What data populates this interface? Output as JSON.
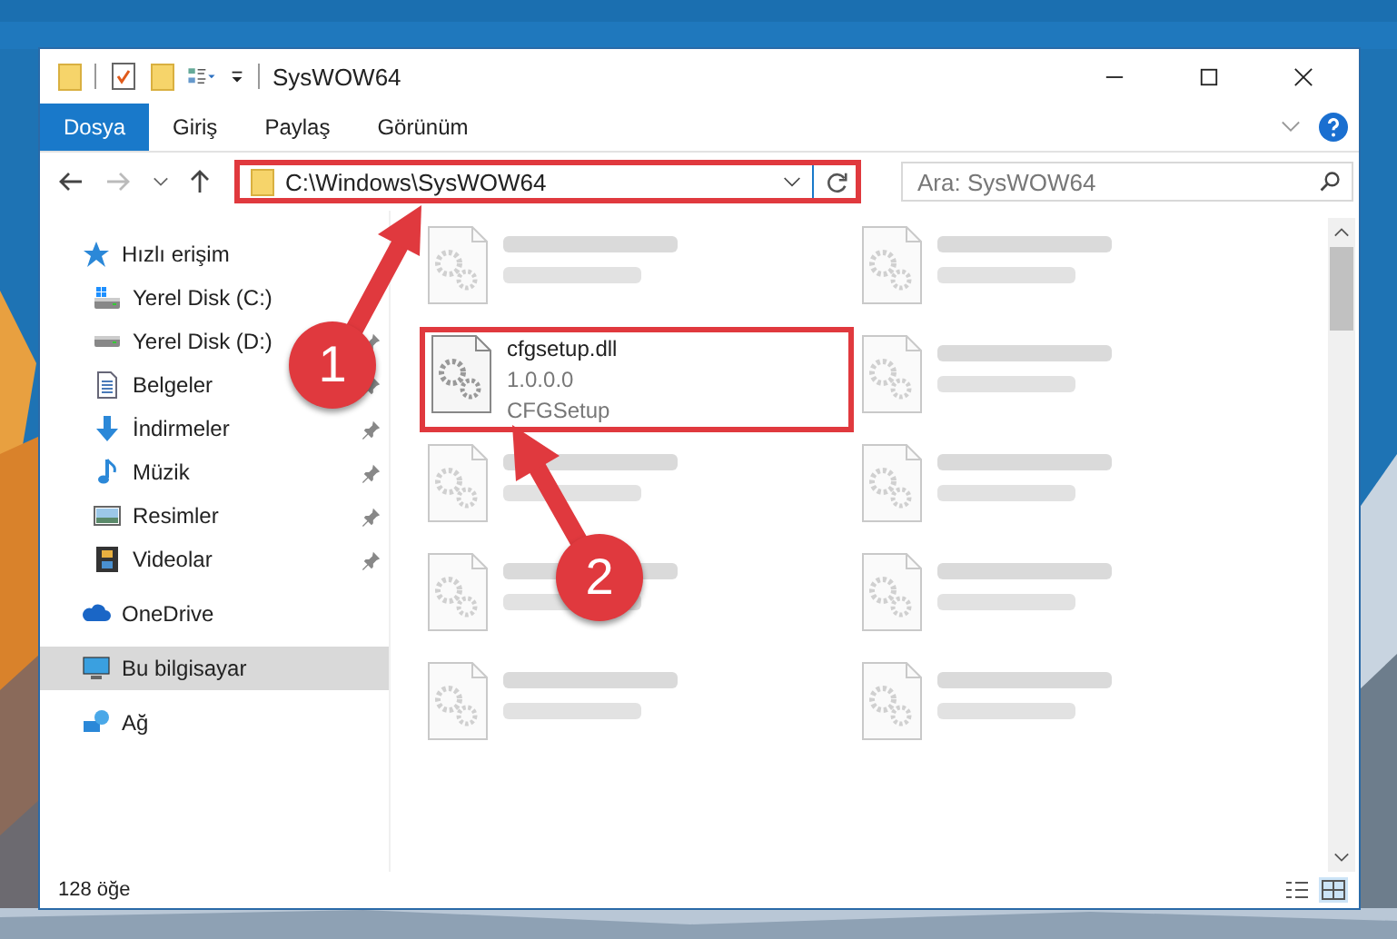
{
  "window": {
    "title": "SysWOW64"
  },
  "ribbon_tabs": [
    {
      "label": "Dosya",
      "selected": true
    },
    {
      "label": "Giriş",
      "selected": false
    },
    {
      "label": "Paylaş",
      "selected": false
    },
    {
      "label": "Görünüm",
      "selected": false
    }
  ],
  "address": {
    "path": "C:\\Windows\\SysWOW64",
    "outlined": true
  },
  "search": {
    "placeholder": "Ara: SysWOW64"
  },
  "nav": [
    {
      "label": "Hızlı erişim",
      "kind": "star",
      "selected": false,
      "children": [
        {
          "label": "Yerel Disk (C:)",
          "kind": "drive-windows",
          "selected": false
        },
        {
          "label": "Yerel Disk (D:)",
          "kind": "drive",
          "pinned": true,
          "selected": false
        },
        {
          "label": "Belgeler",
          "kind": "documents",
          "pinned": true,
          "selected": false
        },
        {
          "label": "İndirmeler",
          "kind": "downloads",
          "pinned": true,
          "selected": false
        },
        {
          "label": "Müzik",
          "kind": "music",
          "pinned": true,
          "selected": false
        },
        {
          "label": "Resimler",
          "kind": "pictures",
          "pinned": true,
          "selected": false
        },
        {
          "label": "Videolar",
          "kind": "videos",
          "pinned": true,
          "selected": false
        }
      ]
    },
    {
      "label": "OneDrive",
      "kind": "cloud",
      "selected": false
    },
    {
      "label": "Bu bilgisayar",
      "kind": "computer",
      "selected": true
    },
    {
      "label": "Ağ",
      "kind": "network",
      "selected": false
    }
  ],
  "files": [
    {
      "blurred": true,
      "outlined": false
    },
    {
      "blurred": true,
      "outlined": false
    },
    {
      "name": "cfgsetup.dll",
      "lines": [
        "1.0.0.0",
        "CFGSetup"
      ],
      "blurred": false,
      "outlined": true
    },
    {
      "blurred": true,
      "outlined": false
    },
    {
      "blurred": true,
      "outlined": false
    },
    {
      "blurred": true,
      "outlined": false
    },
    {
      "blurred": true,
      "outlined": false
    },
    {
      "blurred": true,
      "outlined": false
    },
    {
      "blurred": true,
      "outlined": false
    },
    {
      "blurred": true,
      "outlined": false
    }
  ],
  "status_bar": {
    "count": "128 öğe"
  },
  "callouts": [
    {
      "number": "1"
    },
    {
      "number": "2"
    }
  ]
}
